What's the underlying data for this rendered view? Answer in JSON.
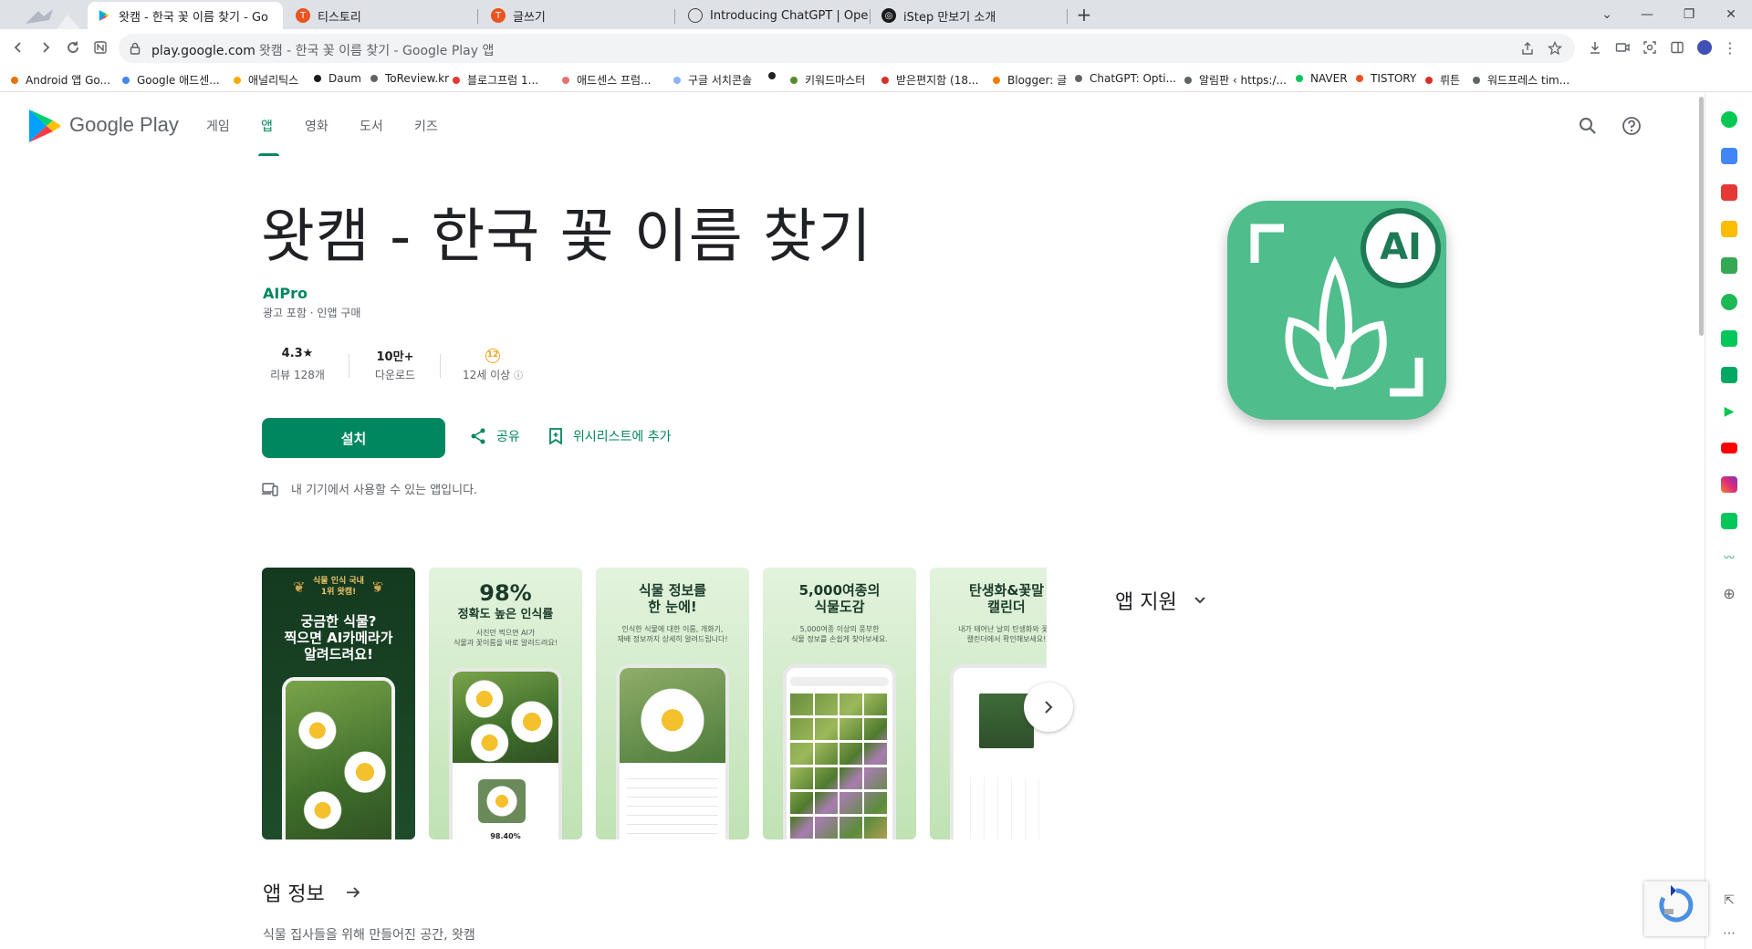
{
  "browser": {
    "tabs": [
      {
        "title": "왓캠 - 한국 꽃 이름 찾기 - Go",
        "favicon": "google-play-icon",
        "active": true
      },
      {
        "title": "티스토리",
        "favicon": "tistory-icon",
        "active": false
      },
      {
        "title": "글쓰기",
        "favicon": "tistory-icon",
        "active": false
      },
      {
        "title": "Introducing ChatGPT | OpenAI",
        "favicon": "openai-icon",
        "active": false
      },
      {
        "title": "iStep 만보기 소개",
        "favicon": "openai-icon",
        "active": false
      }
    ],
    "new_tab_label": "+",
    "url_host": "play.google.com",
    "url_tail": "왓캠 - 한국 꽃 이름 찾기 - Google Play 앱",
    "bookmarks": [
      {
        "label": "Android 앱 Go...",
        "color": "#e37400"
      },
      {
        "label": "Google 애드센...",
        "color": "#4285f4"
      },
      {
        "label": "애널리틱스",
        "color": "#f9ab00"
      },
      {
        "label": "Daum",
        "color": "#1a1a1a"
      },
      {
        "label": "ToReview.kr",
        "color": "#5f6368"
      },
      {
        "label": "블로그프럼 1...",
        "color": "#e53935"
      },
      {
        "label": "애드센스 프럼...",
        "color": "#e57373"
      },
      {
        "label": "구글 서치콘솔",
        "color": "#8ab4f8"
      },
      {
        "label": "",
        "color": "#202124"
      },
      {
        "label": "키워드마스터",
        "color": "#558b2f"
      },
      {
        "label": "받은편지함 (18...",
        "color": "#d93025"
      },
      {
        "label": "Blogger: 글",
        "color": "#f57c00"
      },
      {
        "label": "ChatGPT: Opti...",
        "color": "#5f6368"
      },
      {
        "label": "알림판 ‹ https:/...",
        "color": "#5f6368"
      },
      {
        "label": "NAVER",
        "color": "#03c75a"
      },
      {
        "label": "TISTORY",
        "color": "#eb531f"
      },
      {
        "label": "뤼튼",
        "color": "#d93025"
      },
      {
        "label": "워드프레스 tim...",
        "color": "#5f6368"
      }
    ]
  },
  "play": {
    "brand": "Google Play",
    "nav": [
      "게임",
      "앱",
      "영화",
      "도서",
      "키즈"
    ],
    "active_nav": "앱"
  },
  "app": {
    "title": "왓캠 - 한국 꽃 이름 찾기",
    "developer": "AIPro",
    "sub": "광고 포함 · 인앱 구매",
    "stats": [
      {
        "value": "4.3★",
        "label": "리뷰 128개"
      },
      {
        "value": "10만+",
        "label": "다운로드"
      },
      {
        "value": "12",
        "label": "12세 이상"
      }
    ],
    "install_label": "설치",
    "share_label": "공유",
    "wishlist_label": "위시리스트에 추가",
    "availability": "내 기기에서 사용할 수 있는 앱입니다.",
    "icon_badge": "AI",
    "accent": "#01875f"
  },
  "screenshots": [
    {
      "badge": "식물 인식 국내\n1위 왓캠!",
      "caption": "궁금한 식물?\n찍으면 AI카메라가\n알려드려요!",
      "highlight": "AI카메라",
      "sub": ""
    },
    {
      "badge": "98%",
      "caption": "정확도 높은 인식률",
      "sub": "사진만 찍으면 AI가\n식물과 꽃이름을 바로 알려드려요!",
      "result": "98.40%"
    },
    {
      "badge": "",
      "caption": "식물 정보를\n한 눈에!",
      "sub": "인식한 식물에 대한 이름, 개화기,\n재배 정보까지 상세히 알려드립니다!"
    },
    {
      "badge": "",
      "caption": "5,000여종의\n식물도감",
      "sub": "5,000여종 이상의 풍부한\n식물 정보를 손쉽게 찾아보세요."
    },
    {
      "badge": "",
      "caption": "탄생화&꽃말\n캘린더",
      "sub": "내가 태어난 날의 탄생화와 꽃말\n캘린더에서 확인해보세요!"
    }
  ],
  "support_title": "앱 지원",
  "about": {
    "title": "앱 정보",
    "text": "식물 집사들을 위해 만들어진 공간, 왓캠"
  }
}
